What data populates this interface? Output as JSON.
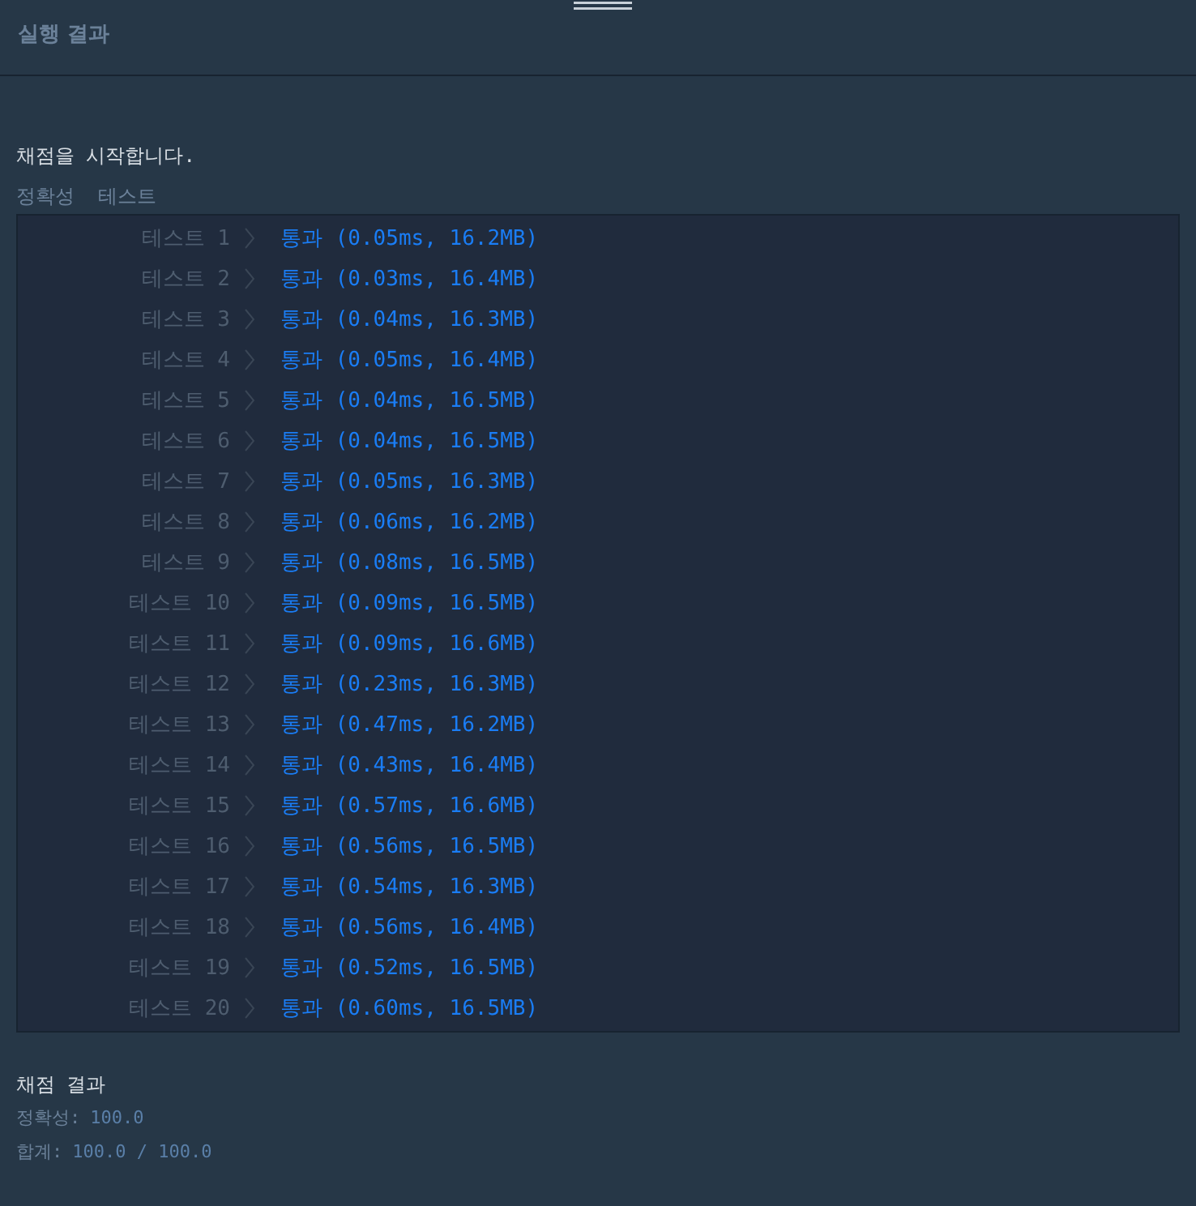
{
  "panel": {
    "title": "실행 결과"
  },
  "output": {
    "intro": "채점을 시작합니다.",
    "section_label": "정확성  테스트",
    "tests": [
      {
        "label": "테스트 1",
        "result": "통과",
        "detail": "(0.05ms, 16.2MB)"
      },
      {
        "label": "테스트 2",
        "result": "통과",
        "detail": "(0.03ms, 16.4MB)"
      },
      {
        "label": "테스트 3",
        "result": "통과",
        "detail": "(0.04ms, 16.3MB)"
      },
      {
        "label": "테스트 4",
        "result": "통과",
        "detail": "(0.05ms, 16.4MB)"
      },
      {
        "label": "테스트 5",
        "result": "통과",
        "detail": "(0.04ms, 16.5MB)"
      },
      {
        "label": "테스트 6",
        "result": "통과",
        "detail": "(0.04ms, 16.5MB)"
      },
      {
        "label": "테스트 7",
        "result": "통과",
        "detail": "(0.05ms, 16.3MB)"
      },
      {
        "label": "테스트 8",
        "result": "통과",
        "detail": "(0.06ms, 16.2MB)"
      },
      {
        "label": "테스트 9",
        "result": "통과",
        "detail": "(0.08ms, 16.5MB)"
      },
      {
        "label": "테스트 10",
        "result": "통과",
        "detail": "(0.09ms, 16.5MB)"
      },
      {
        "label": "테스트 11",
        "result": "통과",
        "detail": "(0.09ms, 16.6MB)"
      },
      {
        "label": "테스트 12",
        "result": "통과",
        "detail": "(0.23ms, 16.3MB)"
      },
      {
        "label": "테스트 13",
        "result": "통과",
        "detail": "(0.47ms, 16.2MB)"
      },
      {
        "label": "테스트 14",
        "result": "통과",
        "detail": "(0.43ms, 16.4MB)"
      },
      {
        "label": "테스트 15",
        "result": "통과",
        "detail": "(0.57ms, 16.6MB)"
      },
      {
        "label": "테스트 16",
        "result": "통과",
        "detail": "(0.56ms, 16.5MB)"
      },
      {
        "label": "테스트 17",
        "result": "통과",
        "detail": "(0.54ms, 16.3MB)"
      },
      {
        "label": "테스트 18",
        "result": "통과",
        "detail": "(0.56ms, 16.4MB)"
      },
      {
        "label": "테스트 19",
        "result": "통과",
        "detail": "(0.52ms, 16.5MB)"
      },
      {
        "label": "테스트 20",
        "result": "통과",
        "detail": "(0.60ms, 16.5MB)"
      }
    ],
    "summary_title": "채점 결과",
    "summary": [
      {
        "label": "정확성:",
        "value": "100.0"
      },
      {
        "label": "합계:",
        "value": "100.0 / 100.0"
      }
    ]
  }
}
